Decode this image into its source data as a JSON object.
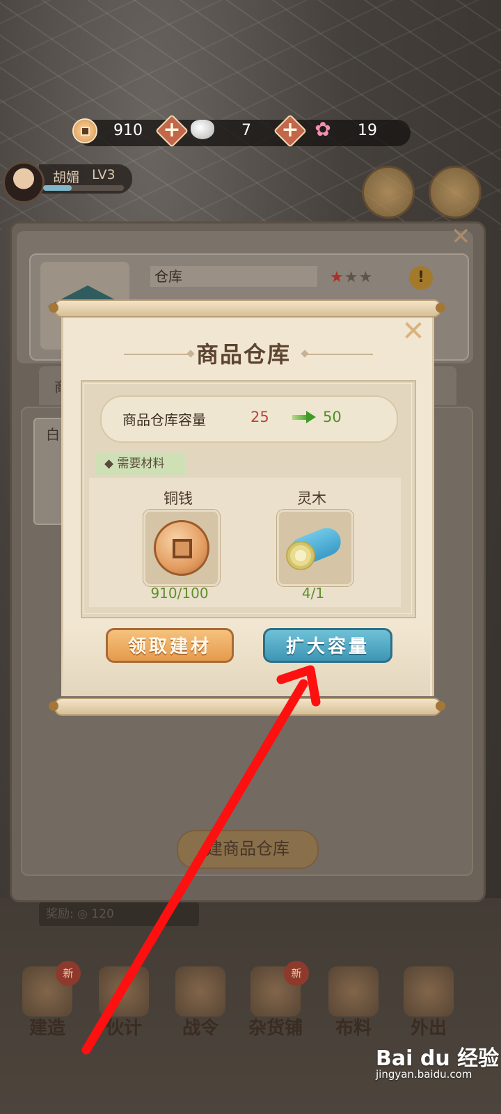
{
  "currency": {
    "coins": "910",
    "silver": "7",
    "flowers": "19"
  },
  "player": {
    "name": "胡媚",
    "level": "LV3",
    "xp_fraction": 0.35
  },
  "background_panel": {
    "building_name": "仓库",
    "tab_label": "商",
    "item_label": "白",
    "build_button": "建商品仓库",
    "reward_label": "奖励:",
    "reward_value": "120"
  },
  "dialog": {
    "title": "商品仓库",
    "capacity_label": "商品仓库容量",
    "capacity_from": "25",
    "capacity_to": "50",
    "materials_tag": "◆ 需要材料",
    "materials": [
      {
        "name": "铜钱",
        "icon": "copper-coin-icon",
        "count": "910/100"
      },
      {
        "name": "灵木",
        "icon": "spirit-wood-log-icon",
        "count": "4/1"
      }
    ],
    "collect_button": "领取建材",
    "expand_button": "扩大容量"
  },
  "bottom_nav": [
    {
      "label": "建造",
      "badge": "新"
    },
    {
      "label": "伙计",
      "badge": ""
    },
    {
      "label": "战令",
      "badge": ""
    },
    {
      "label": "杂货铺",
      "badge": "新"
    },
    {
      "label": "布料",
      "badge": ""
    },
    {
      "label": "外出",
      "badge": ""
    }
  ],
  "watermark": {
    "text": "Bai du 经验",
    "url_text": "jingyan.baidu.com"
  },
  "colors": {
    "accent_blue": "#3d96b5",
    "accent_orange": "#e59a4d",
    "annotation_red": "#ff1010"
  }
}
